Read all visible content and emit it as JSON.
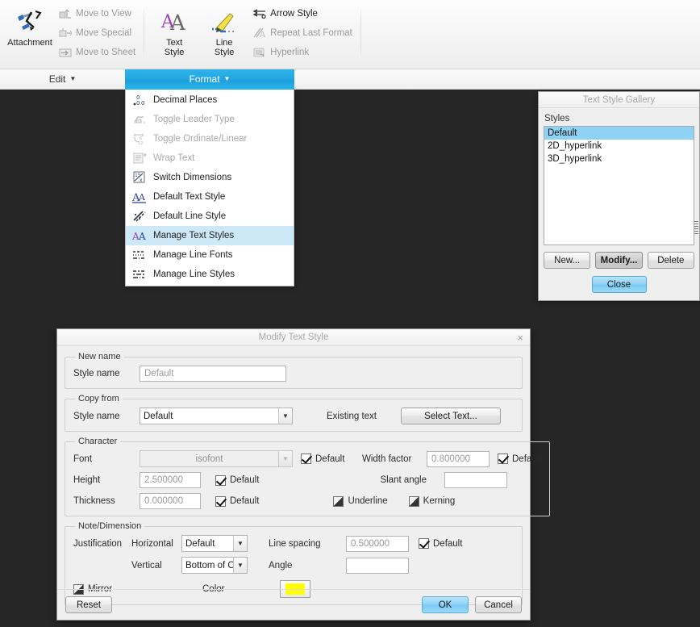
{
  "ribbon": {
    "groups": [
      {
        "name": "attachment-group",
        "big": [
          {
            "label": "Attachment",
            "icon": "attachment-icon",
            "enabled": true
          }
        ],
        "small": [
          {
            "label": "Move to View",
            "icon": "move-to-view-icon",
            "enabled": false
          },
          {
            "label": "Move Special",
            "icon": "move-special-icon",
            "enabled": false
          },
          {
            "label": "Move to Sheet",
            "icon": "move-to-sheet-icon",
            "enabled": false
          }
        ]
      },
      {
        "name": "style-group",
        "big": [
          {
            "label": "Text\nStyle",
            "label_l1": "Text",
            "label_l2": "Style",
            "icon": "text-style-icon",
            "enabled": true
          },
          {
            "label": "Line\nStyle",
            "label_l1": "Line",
            "label_l2": "Style",
            "icon": "line-style-icon",
            "enabled": true
          }
        ],
        "small": [
          {
            "label": "Arrow Style",
            "icon": "arrow-style-icon",
            "enabled": true
          },
          {
            "label": "Repeat Last Format",
            "icon": "repeat-last-format-icon",
            "enabled": false
          },
          {
            "label": "Hyperlink",
            "icon": "hyperlink-icon",
            "enabled": false
          }
        ]
      }
    ]
  },
  "tabs": [
    {
      "label": "Edit",
      "active": false,
      "caret": "▼"
    },
    {
      "label": "Format",
      "active": true,
      "caret": "▼"
    }
  ],
  "menu": {
    "items": [
      {
        "label": "Decimal Places",
        "icon": "decimal-places-icon",
        "enabled": true,
        "highlighted": false
      },
      {
        "label": "Toggle Leader Type",
        "icon": "toggle-leader-type-icon",
        "enabled": false,
        "highlighted": false
      },
      {
        "label": "Toggle Ordinate/Linear",
        "icon": "toggle-ordinate-linear-icon",
        "enabled": false,
        "highlighted": false
      },
      {
        "label": "Wrap Text",
        "icon": "wrap-text-icon",
        "enabled": false,
        "highlighted": false
      },
      {
        "label": "Switch Dimensions",
        "icon": "switch-dimensions-icon",
        "enabled": true,
        "highlighted": false
      },
      {
        "label": "Default Text Style",
        "icon": "default-text-style-icon",
        "enabled": true,
        "highlighted": false
      },
      {
        "label": "Default Line Style",
        "icon": "default-line-style-icon",
        "enabled": true,
        "highlighted": false
      },
      {
        "label": "Manage Text Styles",
        "icon": "manage-text-styles-icon",
        "enabled": true,
        "highlighted": true
      },
      {
        "label": "Manage Line Fonts",
        "icon": "manage-line-fonts-icon",
        "enabled": true,
        "highlighted": false
      },
      {
        "label": "Manage Line Styles",
        "icon": "manage-line-styles-icon",
        "enabled": true,
        "highlighted": false
      }
    ]
  },
  "gallery": {
    "title": "Text Style Gallery",
    "styles_label": "Styles",
    "styles": [
      {
        "name": "Default",
        "selected": true
      },
      {
        "name": "2D_hyperlink",
        "selected": false
      },
      {
        "name": "3D_hyperlink",
        "selected": false
      }
    ],
    "buttons": {
      "new": "New...",
      "modify": "Modify...",
      "delete": "Delete",
      "close": "Close"
    }
  },
  "dialog": {
    "title": "Modify Text Style",
    "close_icon": "×",
    "new_name": {
      "legend": "New name",
      "style_name_label": "Style name",
      "style_name_value": "Default"
    },
    "copy_from": {
      "legend": "Copy from",
      "style_name_label": "Style name",
      "style_name_value": "Default",
      "existing_text_label": "Existing text",
      "select_text_button": "Select Text..."
    },
    "character": {
      "legend": "Character",
      "font_label": "Font",
      "font_value": "isofont",
      "font_default_label": "Default",
      "font_default_checked": true,
      "width_factor_label": "Width factor",
      "width_factor_value": "0.800000",
      "width_factor_default_label": "Default",
      "width_factor_default_checked": true,
      "height_label": "Height",
      "height_value": "2.500000",
      "height_default_label": "Default",
      "height_default_checked": true,
      "slant_angle_label": "Slant angle",
      "slant_angle_value": "",
      "thickness_label": "Thickness",
      "thickness_value": "0.000000",
      "thickness_default_label": "Default",
      "thickness_default_checked": true,
      "underline_label": "Underline",
      "kerning_label": "Kerning"
    },
    "note_dimension": {
      "legend": "Note/Dimension",
      "justification_label": "Justification",
      "horizontal_label": "Horizontal",
      "horizontal_value": "Default",
      "vertical_label": "Vertical",
      "vertical_value": "Bottom of Orig",
      "line_spacing_label": "Line spacing",
      "line_spacing_value": "0.500000",
      "line_spacing_default_label": "Default",
      "line_spacing_default_checked": true,
      "angle_label": "Angle",
      "angle_value": "",
      "mirror_label": "Mirror",
      "color_label": "Color",
      "color_value": "#ffff00"
    },
    "footer": {
      "reset": "Reset",
      "ok": "OK",
      "cancel": "Cancel"
    }
  },
  "colors": {
    "accent": "#23a7e2",
    "menu_highlight": "#cde8f7",
    "list_selection": "#8ed3f4",
    "canvas": "#262626",
    "color_swatch": "#ffff00"
  }
}
